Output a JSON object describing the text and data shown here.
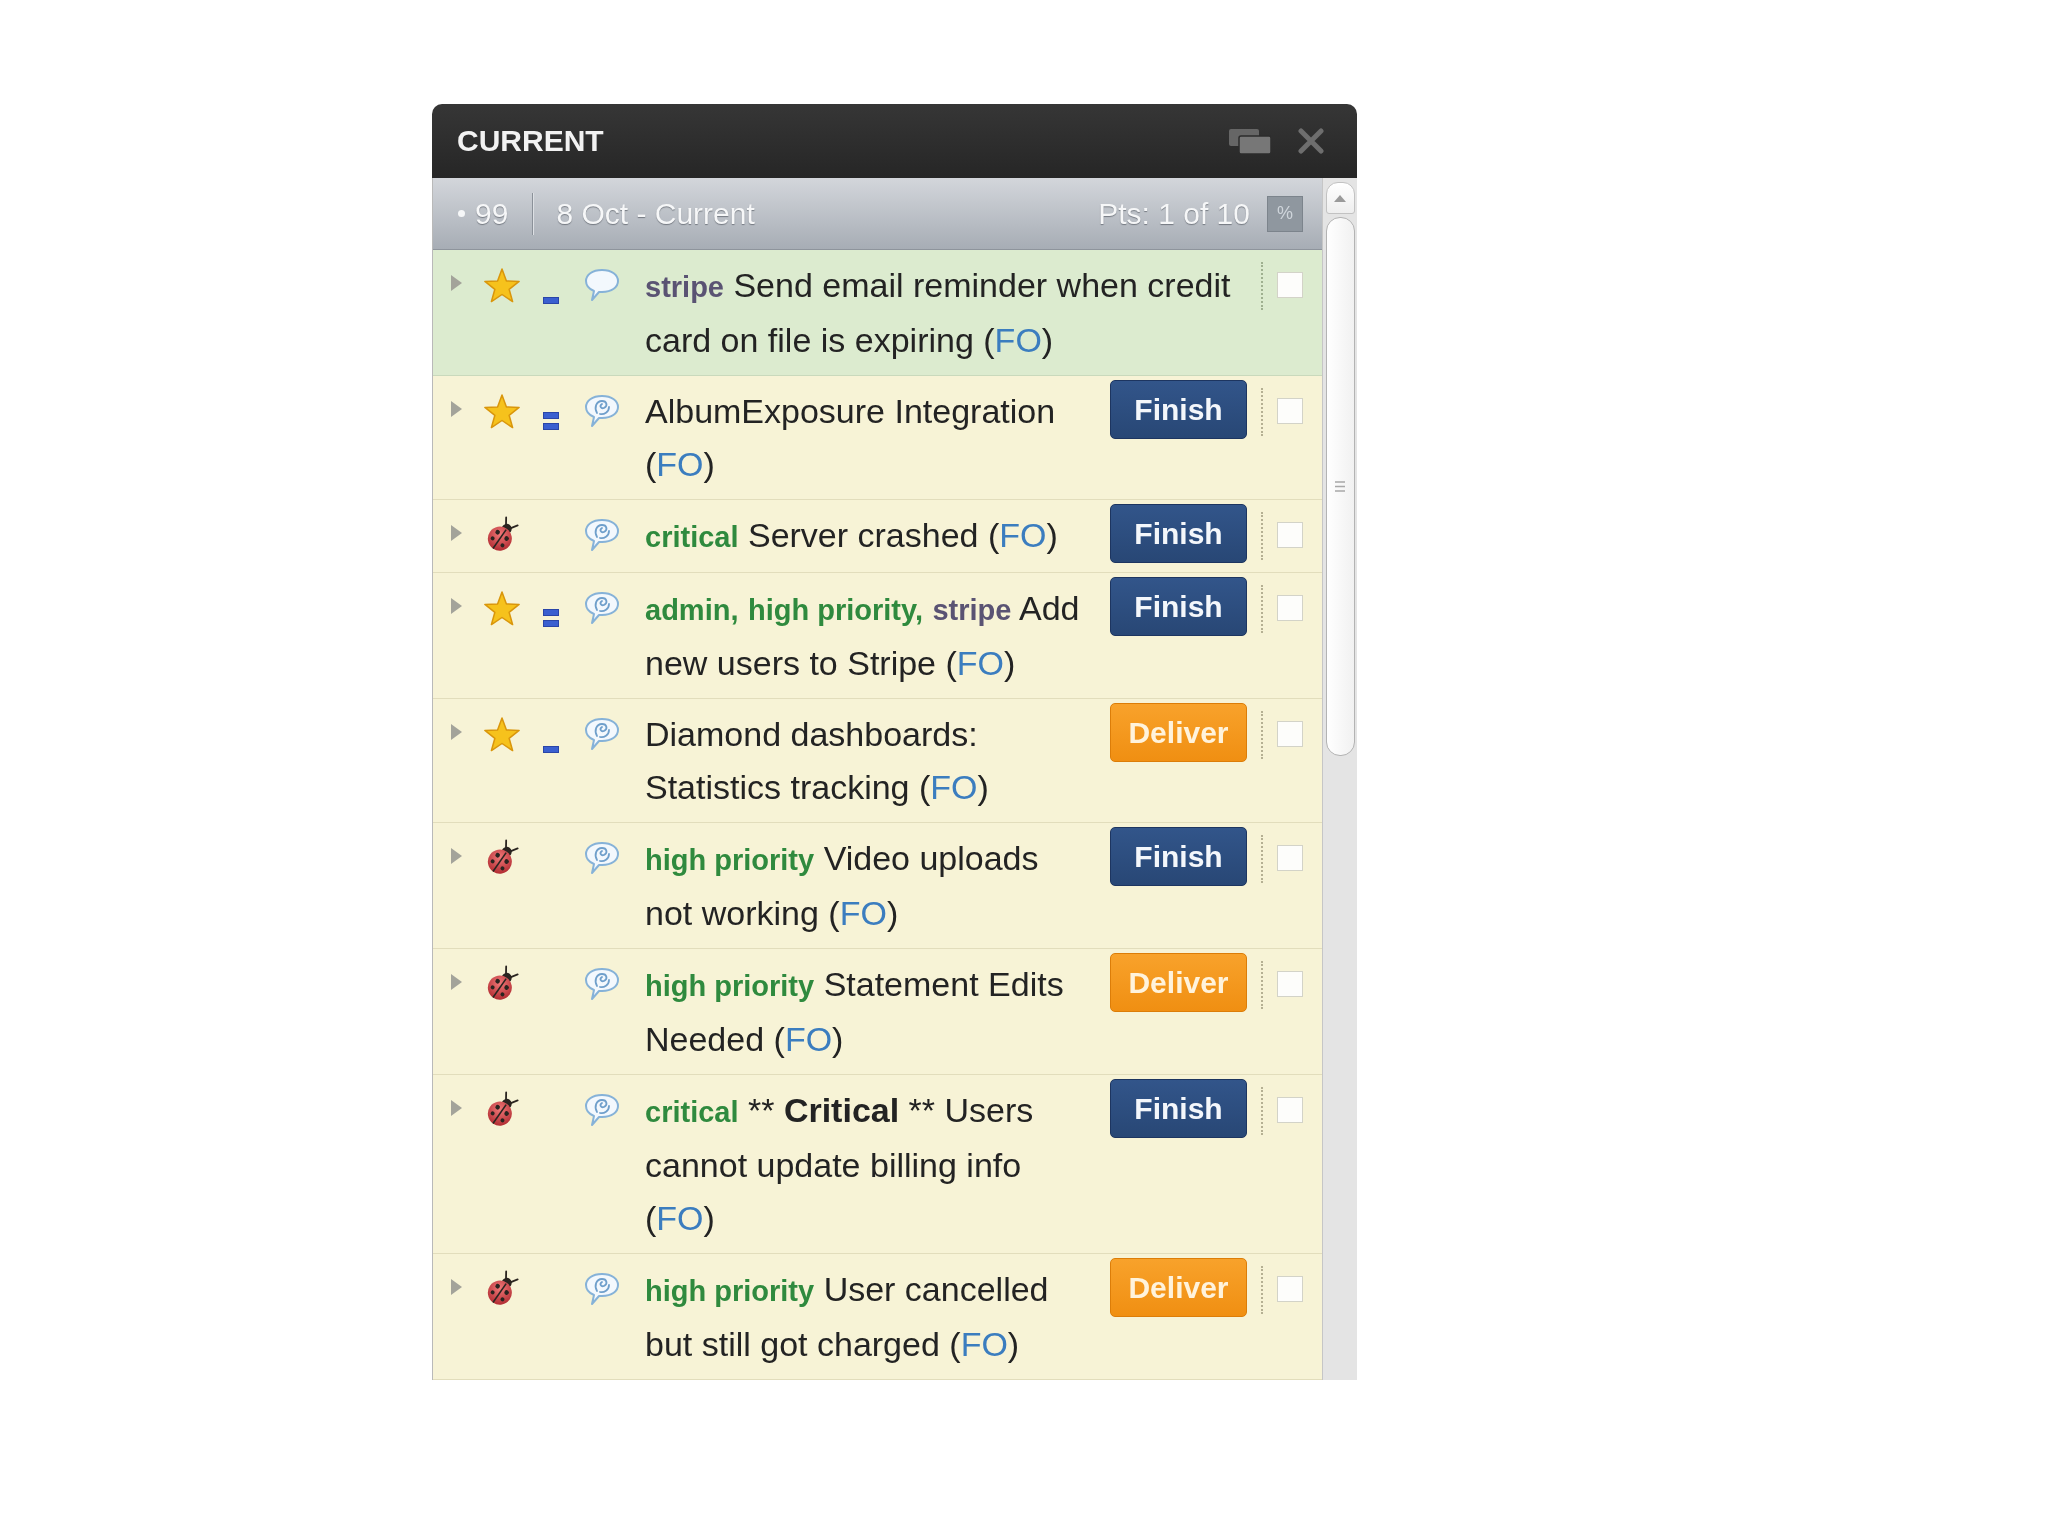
{
  "window": {
    "title": "CURRENT"
  },
  "iteration_bar": {
    "number": "99",
    "dates": "8 Oct - Current",
    "points": "Pts: 1 of 10",
    "percent_toggle": "%"
  },
  "stories": [
    {
      "expanded": false,
      "kind": "feature",
      "estimate": {
        "kind": "one_bar"
      },
      "has_comments": false,
      "accepted": true,
      "labels": [
        {
          "text": "stripe",
          "color": "#5a5373"
        }
      ],
      "title": [
        {
          "text": "Send email reminder when credit card on file is expiring",
          "bold": false
        }
      ],
      "owner": {
        "open": "(",
        "initials": "FO",
        "close": ")"
      },
      "checked": false
    },
    {
      "expanded": false,
      "kind": "feature",
      "estimate": {
        "kind": "two_bars"
      },
      "has_comments": true,
      "accepted": false,
      "title": [
        {
          "text": "AlbumExposure Integration",
          "bold": false
        }
      ],
      "owner": {
        "open": "(",
        "initials": "FO",
        "close": ")"
      },
      "action": {
        "label": "Finish",
        "kind": "finish"
      },
      "checked": false
    },
    {
      "expanded": false,
      "kind": "bug",
      "has_comments": true,
      "accepted": false,
      "labels": [
        {
          "text": "critical",
          "color": "#2f8a3e"
        }
      ],
      "title": [
        {
          "text": "Server crashed",
          "bold": false
        }
      ],
      "owner": {
        "open": "(",
        "initials": "FO",
        "close": ")"
      },
      "action": {
        "label": "Finish",
        "kind": "finish"
      },
      "checked": false
    },
    {
      "expanded": false,
      "kind": "feature",
      "estimate": {
        "kind": "two_bars"
      },
      "has_comments": true,
      "accepted": false,
      "labels": [
        {
          "text": "admin,",
          "color": "#2f8a3e"
        },
        {
          "text": "high priority,",
          "color": "#2f8a3e"
        },
        {
          "text": "stripe",
          "color": "#5a5373"
        }
      ],
      "title": [
        {
          "text": "Add new users to Stripe",
          "bold": false
        }
      ],
      "owner": {
        "open": "(",
        "initials": "FO",
        "close": ")"
      },
      "action": {
        "label": "Finish",
        "kind": "finish"
      },
      "checked": false
    },
    {
      "expanded": false,
      "kind": "feature",
      "estimate": {
        "kind": "one_bar"
      },
      "has_comments": true,
      "accepted": false,
      "title": [
        {
          "text": "Diamond dashboards: Statistics tracking",
          "bold": false
        }
      ],
      "owner": {
        "open": "(",
        "initials": "FO",
        "close": ")"
      },
      "action": {
        "label": "Deliver",
        "kind": "deliver"
      },
      "checked": false
    },
    {
      "expanded": false,
      "kind": "bug",
      "has_comments": true,
      "accepted": false,
      "labels": [
        {
          "text": "high priority",
          "color": "#2f8a3e"
        }
      ],
      "title": [
        {
          "text": "Video uploads not working",
          "bold": false
        }
      ],
      "owner": {
        "open": "(",
        "initials": "FO",
        "close": ")"
      },
      "action": {
        "label": "Finish",
        "kind": "finish"
      },
      "checked": false
    },
    {
      "expanded": false,
      "kind": "bug",
      "has_comments": true,
      "accepted": false,
      "labels": [
        {
          "text": "high priority",
          "color": "#2f8a3e"
        }
      ],
      "title": [
        {
          "text": "Statement Edits Needed",
          "bold": false
        }
      ],
      "owner": {
        "open": "(",
        "initials": "FO",
        "close": ")"
      },
      "action": {
        "label": "Deliver",
        "kind": "deliver"
      },
      "checked": false
    },
    {
      "expanded": false,
      "kind": "bug",
      "has_comments": true,
      "accepted": false,
      "labels": [
        {
          "text": "critical",
          "color": "#2f8a3e"
        }
      ],
      "title": [
        {
          "text": "**",
          "bold": false
        },
        {
          "text": "Critical",
          "bold": true
        },
        {
          "text": "** Users cannot update billing info",
          "bold": false
        }
      ],
      "owner": {
        "open": "(",
        "initials": "FO",
        "close": ")"
      },
      "action": {
        "label": "Finish",
        "kind": "finish"
      },
      "checked": false
    },
    {
      "expanded": false,
      "kind": "bug",
      "has_comments": true,
      "accepted": false,
      "labels": [
        {
          "text": "high priority",
          "color": "#2f8a3e"
        }
      ],
      "title": [
        {
          "text": "User cancelled but still got charged",
          "bold": false
        }
      ],
      "owner": {
        "open": "(",
        "initials": "FO",
        "close": ")"
      },
      "action": {
        "label": "Deliver",
        "kind": "deliver"
      },
      "checked": false
    }
  ]
}
